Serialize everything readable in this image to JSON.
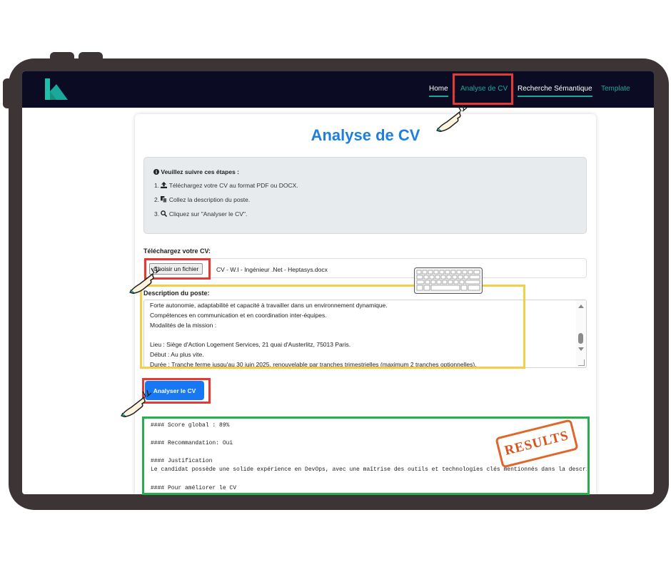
{
  "navbar": {
    "links": [
      {
        "label": "Home"
      },
      {
        "label": "Analyse de CV"
      },
      {
        "label": "Recherche Sémantique"
      },
      {
        "label": "Template"
      }
    ]
  },
  "page": {
    "title": "Analyse de CV"
  },
  "instructions": {
    "heading": "Veuillez suivre ces étapes :",
    "steps": [
      {
        "num": "1.",
        "text": "Téléchargez votre CV au format PDF ou DOCX."
      },
      {
        "num": "2.",
        "text": "Collez la description du poste."
      },
      {
        "num": "3.",
        "text": "Cliquez sur \"Analyser le CV\"."
      }
    ]
  },
  "upload": {
    "label": "Téléchargez votre CV:",
    "button_label": "Choisir un fichier",
    "file_name": "CV - W.I - Ingénieur .Net - Heptasys.docx"
  },
  "description": {
    "label": "Description du poste:",
    "lines": [
      "Forte autonomie, adaptabilité et capacité à travailler dans un environnement dynamique.",
      "Compétences en communication et en coordination inter-équipes.",
      "Modalités de la mission :",
      "",
      "Lieu : Siège d'Action Logement Services, 21 quai d'Austerlitz, 75013 Paris.",
      "Début : Au plus vite.",
      "Durée : Tranche ferme jusqu'au 30 juin 2025, renouvelable par tranches trimestrielles (maximum 2 tranches optionnelles)."
    ]
  },
  "analyze": {
    "button_label": "Analyser le CV"
  },
  "results": {
    "lines": [
      "#### Score global : 89%",
      "",
      "#### Recommandation: Oui",
      "",
      "#### Justification",
      "Le candidat possède une solide expérience en DevOps, avec une maîtrise des outils et technologies clés mentionnés dans la description",
      "",
      "#### Pour améliorer le CV"
    ],
    "stamp_text": "RESULTS"
  },
  "colors": {
    "navbar_bg": "#0b0c24",
    "accent_teal": "#1aa89a",
    "title_blue": "#1d7fe0",
    "button_blue": "#1877f2",
    "highlight_red": "#e53935",
    "highlight_yellow": "#f2cf45",
    "highlight_green": "#22b14c",
    "frame": "#3d3535"
  },
  "icons": {
    "heading": "info-circle-icon",
    "step1": "upload-icon",
    "step2": "copy-icon",
    "step3": "search-icon"
  }
}
